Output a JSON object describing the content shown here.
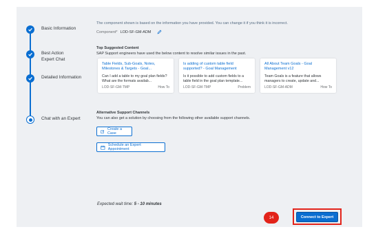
{
  "steps": [
    {
      "label": "Basic Information",
      "state": "done"
    },
    {
      "label": "Best Action",
      "sub": "Expert Chat",
      "state": "done"
    },
    {
      "label": "Detailed Information",
      "state": "done"
    },
    {
      "label": "Chat with an Expert",
      "state": "current"
    }
  ],
  "component": {
    "info": "The component shown is based on the information you have provided. You can change it if you think it is incorrect.",
    "label": "Component*",
    "value": "LOD-SF-GM-ADM"
  },
  "suggested": {
    "title": "Top Suggested Content",
    "subtitle": "SAP Support engineers have used the below content to resolve similar issues in the past.",
    "cards": [
      {
        "title": "Table Fields, Sub-Goals, Notes, Milestones & Targets - Goal...",
        "desc": "Can I add a table to my goal plan fields? What are the formats availab...",
        "component": "LOD-SF-GM-TMP",
        "type": "How To"
      },
      {
        "title": "Is adding of custom table field supported? - Goal Management",
        "desc": "Is it possible to add custom fields to a table field in the goal plan template...",
        "component": "LOD-SF-GM-TMP",
        "type": "Problem"
      },
      {
        "title": "All About Team Goals - Goal Management v12",
        "desc": "Team Goals is a feature that allows managers to create, update and...",
        "component": "LOD-SF-GM-ADM",
        "type": "How To"
      }
    ]
  },
  "alternative": {
    "title": "Alternative Support Channels",
    "subtitle": "You can also get a solution by choosing from the following other available support channels.",
    "create_case": "Create a Case",
    "schedule": "Schedule an Expert Appointment"
  },
  "wait": {
    "prefix": "Expected wait time: ",
    "value": "5 - 10 minutes"
  },
  "badge": "14",
  "connect_label": "Connect to Expert",
  "colors": {
    "accent": "#0a6ed1",
    "highlight": "#e2231a",
    "panel": "#eef0f3"
  }
}
